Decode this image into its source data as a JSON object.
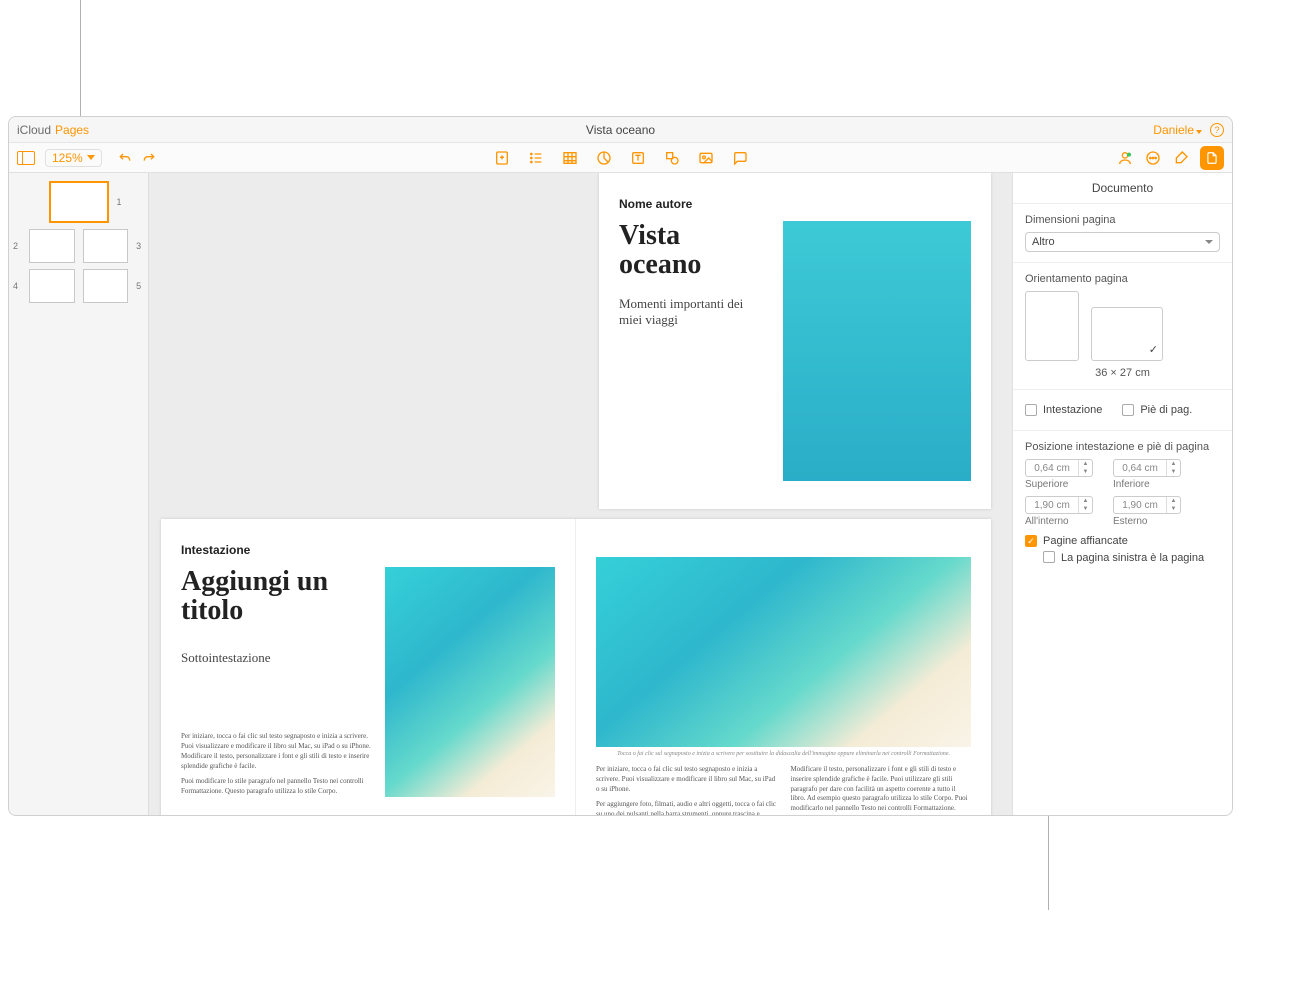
{
  "titlebar": {
    "app1": "iCloud",
    "app2": "Pages",
    "doc": "Vista oceano",
    "user": "Daniele"
  },
  "toolbar": {
    "zoom": "125%"
  },
  "thumbs": {
    "p1": "1",
    "p2": "2",
    "p3": "3",
    "p4": "4",
    "p5": "5"
  },
  "page1": {
    "author": "Nome autore",
    "title1": "Vista",
    "title2": "oceano",
    "sub": "Momenti importanti dei miei viaggi"
  },
  "page2": {
    "hdr": "Intestazione",
    "title1": "Aggiungi un",
    "title2": "titolo",
    "sub": "Sottointestazione",
    "body1": "Per iniziare, tocca o fai clic sul testo segnaposto e inizia a scrivere. Puoi visualizzare e modificare il libro sul Mac, su iPad o su iPhone. Modificare il testo, personalizzare i font e gli stili di testo e inserire splendide grafiche è facile.",
    "body2": "Puoi modificare lo stile paragrafo nel pannello Testo nei controlli Formattazione. Questo paragrafo utilizza lo stile Corpo."
  },
  "page3": {
    "cap": "Tocca o fai clic sul segnaposto e inizia a scrivere per sostituire la didascalia dell'immagine oppure eliminarla nei controlli Formattazione.",
    "colA1": "Per iniziare, tocca o fai clic sul testo segnaposto e inizia a scrivere. Puoi visualizzare e modificare il libro sul Mac, su iPad o su iPhone.",
    "colA2": "Per aggiungere foto, filmati, audio e altri oggetti, tocca o fai clic su uno dei pulsanti nella barra strumenti, oppure trascina e rilascia gli oggetti desiderati sulla pagina.",
    "colB": "Modificare il testo, personalizzare i font e gli stili di testo e inserire splendide grafiche è facile. Puoi utilizzare gli stili paragrafo per dare con facilità un aspetto coerente a tutto il libro. Ad esempio questo paragrafo utilizza lo stile Corpo. Puoi modificarlo nel pannello Testo nei controlli Formattazione."
  },
  "inspector": {
    "title": "Documento",
    "pagesize_lbl": "Dimensioni pagina",
    "pagesize_val": "Altro",
    "orient_lbl": "Orientamento pagina",
    "dims": "36 × 27 cm",
    "header_chk": "Intestazione",
    "footer_chk": "Piè di pag.",
    "hf_pos_lbl": "Posizione intestazione e piè di pagina",
    "m_top_v": "0,64 cm",
    "m_top_l": "Superiore",
    "m_bot_v": "0,64 cm",
    "m_bot_l": "Inferiore",
    "m_in_v": "1,90 cm",
    "m_in_l": "All'interno",
    "m_out_v": "1,90 cm",
    "m_out_l": "Esterno",
    "facing": "Pagine affiancate",
    "left_starts": "La pagina sinistra è la pagina"
  }
}
